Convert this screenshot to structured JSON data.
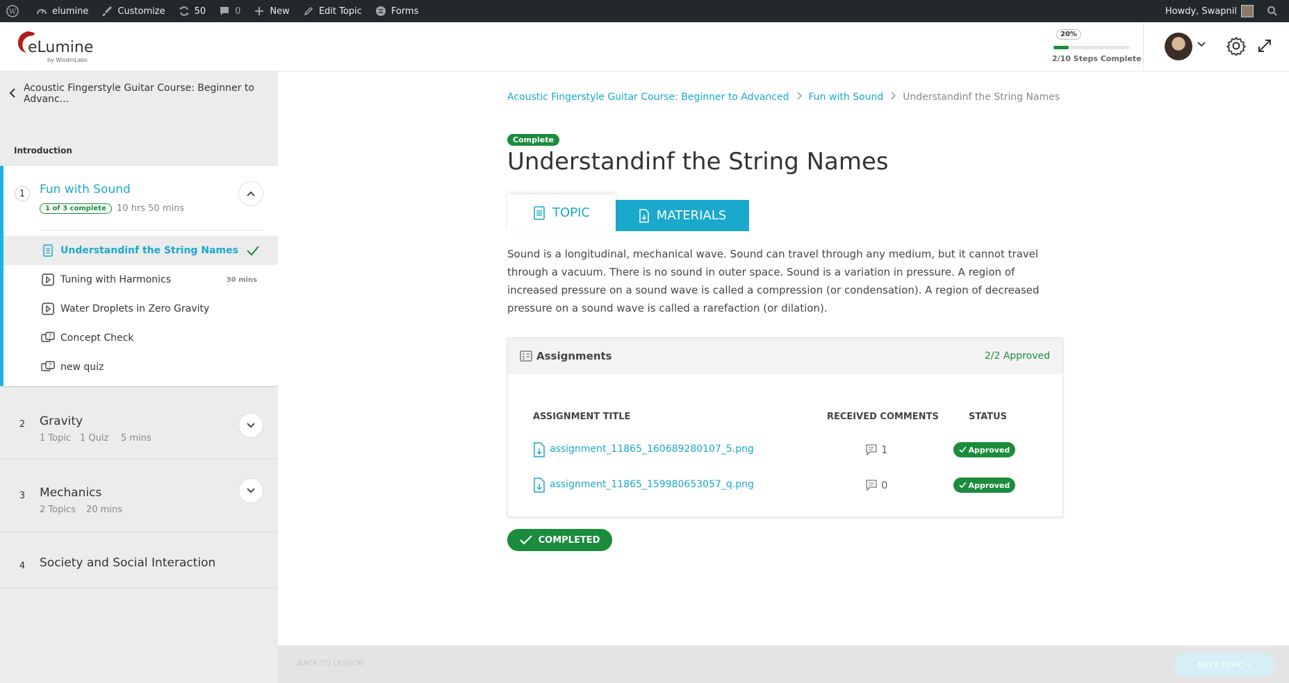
{
  "adminbar": {
    "site_name": "elumine",
    "customize": "Customize",
    "updates_count": "50",
    "comments_count": "0",
    "new_label": "New",
    "edit_label": "Edit Topic",
    "forms_label": "Forms",
    "greeting": "Howdy, Swapnil"
  },
  "header": {
    "logo_text": "eLumine",
    "logo_sub": "by WisdmLabs",
    "progress_percent_label": "20%",
    "progress_fraction": 0.2,
    "progress_text": "2/10 Steps Complete"
  },
  "sidebar": {
    "back_label": "Acoustic Fingerstyle Guitar Course: Beginner to Advanc...",
    "section_label": "Introduction",
    "lessons": [
      {
        "num": "1",
        "title": "Fun with Sound",
        "badge": "1 of 3 complete",
        "meta": "10 hrs 50 mins",
        "topics": [
          {
            "label": "Understandinf the String Names",
            "icon": "document-icon",
            "duration": ""
          },
          {
            "label": "Tuning with Harmonics",
            "icon": "video-icon",
            "duration": "30 mins"
          },
          {
            "label": "Water Droplets in Zero Gravity",
            "icon": "video-icon",
            "duration": ""
          },
          {
            "label": "Concept Check",
            "icon": "quiz-icon",
            "duration": ""
          },
          {
            "label": "new quiz",
            "icon": "quiz-icon",
            "duration": ""
          }
        ]
      },
      {
        "num": "2",
        "title": "Gravity",
        "meta_a": "1 Topic",
        "meta_b": "1 Quiz",
        "meta_c": "5 mins"
      },
      {
        "num": "3",
        "title": "Mechanics",
        "meta_a": "2 Topics",
        "meta_b": "20 mins"
      },
      {
        "num": "4",
        "title": "Society and Social Interaction"
      }
    ]
  },
  "breadcrumb": {
    "course": "Acoustic Fingerstyle Guitar Course: Beginner to Advanced",
    "lesson": "Fun with Sound",
    "current": "Understandinf the String Names"
  },
  "topic": {
    "status_badge": "Complete",
    "title": "Understandinf the String Names",
    "tab_topic": "TOPIC",
    "tab_materials": "MATERIALS",
    "body": "Sound is a longitudinal, mechanical wave. Sound can travel through any medium, but it cannot travel through a vacuum. There is no sound in outer space. Sound is a variation in pressure. A region of increased pressure on a sound wave is called a compression (or condensation). A region of decreased pressure on a sound wave is called a rarefaction (or dilation)."
  },
  "assignments": {
    "title": "Assignments",
    "approved_summary": "2/2 Approved",
    "col_title": "ASSIGNMENT TITLE",
    "col_comments": "RECEIVED COMMENTS",
    "col_status": "STATUS",
    "rows": [
      {
        "file": "assignment_11865_160689280107_5.png",
        "comments": "1",
        "status": "Approved"
      },
      {
        "file": "assignment_11865_159980653057_q.png",
        "comments": "0",
        "status": "Approved"
      }
    ]
  },
  "completed_label": "COMPLETED",
  "footer": {
    "back_label": "BACK TO LESSON",
    "next_label": "NEXT TOPIC"
  },
  "colors": {
    "accent": "#1aa8cc",
    "success": "#1a8c3c",
    "adminbar": "#23282d"
  }
}
